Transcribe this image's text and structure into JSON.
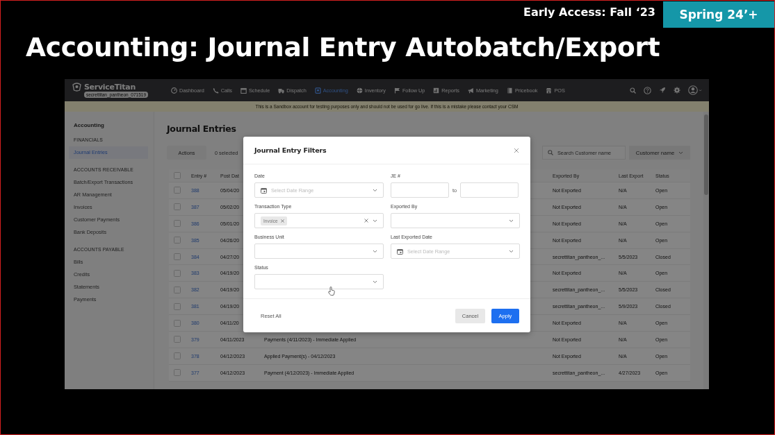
{
  "slide": {
    "early_access": "Early Access: Fall ‘23",
    "release_tag": "Spring 24’+",
    "title": "Accounting: Journal Entry Autobatch/Export"
  },
  "app": {
    "nav": {
      "logo": "ServiceTitan",
      "account": "secrettitan_pantheon_071519",
      "items": [
        {
          "label": "Dashboard",
          "selected": false
        },
        {
          "label": "Calls",
          "selected": false
        },
        {
          "label": "Schedule",
          "selected": false
        },
        {
          "label": "Dispatch",
          "selected": false
        },
        {
          "label": "Accounting",
          "selected": true
        },
        {
          "label": "Inventory",
          "selected": false
        },
        {
          "label": "Follow Up",
          "selected": false
        },
        {
          "label": "Reports",
          "selected": false
        },
        {
          "label": "Marketing",
          "selected": false
        },
        {
          "label": "Pricebook",
          "selected": false
        },
        {
          "label": "POS",
          "selected": false
        }
      ]
    },
    "banner": "This is a Sandbox account for testing purposes only and should not be used for go live. If this is a mistake please contact your CSM",
    "sidebar": {
      "heading": "Accounting",
      "sections": [
        {
          "title": "FINANCIALS",
          "items": [
            {
              "label": "Journal Entries",
              "selected": true
            }
          ]
        },
        {
          "title": "ACCOUNTS RECEIVABLE",
          "items": [
            {
              "label": "Batch/Export Transactions",
              "selected": false
            },
            {
              "label": "AR Management",
              "selected": false
            },
            {
              "label": "Invoices",
              "selected": false
            },
            {
              "label": "Customer Payments",
              "selected": false
            },
            {
              "label": "Bank Deposits",
              "selected": false
            }
          ]
        },
        {
          "title": "ACCOUNTS PAYABLE",
          "items": [
            {
              "label": "Bills",
              "selected": false
            },
            {
              "label": "Credits",
              "selected": false
            },
            {
              "label": "Statements",
              "selected": false
            },
            {
              "label": "Payments",
              "selected": false
            }
          ]
        }
      ]
    },
    "page_title": "Journal Entries",
    "toolbar": {
      "actions": "Actions",
      "selected_count": "0 selected",
      "search_placeholder": "Search Customer name",
      "filter_dropdown": "Customer name"
    },
    "table": {
      "select_all_checked": false,
      "columns": [
        "Entry #",
        "Post Dat",
        "Exported By",
        "Last Export",
        "Status"
      ],
      "rows": [
        {
          "checked": false,
          "entry": "388",
          "post_date": "05/04/20",
          "exported_by": "Not Exported",
          "last_export": "N/A",
          "status": "Open"
        },
        {
          "checked": false,
          "entry": "387",
          "post_date": "05/02/20",
          "exported_by": "Not Exported",
          "last_export": "N/A",
          "status": "Open"
        },
        {
          "checked": false,
          "entry": "386",
          "post_date": "05/01/20",
          "exported_by": "Not Exported",
          "last_export": "N/A",
          "status": "Open"
        },
        {
          "checked": false,
          "entry": "385",
          "post_date": "04/26/20",
          "exported_by": "Not Exported",
          "last_export": "N/A",
          "status": "Open"
        },
        {
          "checked": false,
          "entry": "384",
          "post_date": "04/27/20",
          "exported_by": "secrettitan_pantheon_...",
          "last_export": "5/5/2023",
          "status": "Closed"
        },
        {
          "checked": false,
          "entry": "383",
          "post_date": "04/19/20",
          "exported_by": "Not Exported",
          "last_export": "N/A",
          "status": "Open"
        },
        {
          "checked": false,
          "entry": "382",
          "post_date": "04/19/20",
          "exported_by": "secrettitan_pantheon_...",
          "last_export": "5/5/2023",
          "status": "Closed"
        },
        {
          "checked": false,
          "entry": "381",
          "post_date": "04/19/20",
          "exported_by": "secrettitan_pantheon_...",
          "last_export": "5/9/2023",
          "status": "Closed"
        },
        {
          "checked": false,
          "entry": "380",
          "post_date": "04/11/20",
          "exported_by": "Not Exported",
          "last_export": "N/A",
          "status": "Open"
        },
        {
          "checked": false,
          "entry": "379",
          "post_date": "04/11/2023",
          "description": "Payments (4/11/2023) - Immediate Applied",
          "exported_by": "Not Exported",
          "last_export": "N/A",
          "status": "Open"
        },
        {
          "checked": false,
          "entry": "378",
          "post_date": "04/12/2023",
          "description": "Applied Payment(s) - 04/12/2023",
          "exported_by": "Not Exported",
          "last_export": "N/A",
          "status": "Open"
        },
        {
          "checked": false,
          "entry": "377",
          "post_date": "04/12/2023",
          "description": "Payment (4/12/2023) - Immediate Applied",
          "exported_by": "secrettitan_pantheon_...",
          "last_export": "4/27/2023",
          "status": "Open"
        }
      ]
    },
    "modal": {
      "title": "Journal Entry Filters",
      "fields": [
        {
          "label": "Date",
          "kind": "date-range",
          "placeholder": "Select Date Range"
        },
        {
          "label": "JE #",
          "kind": "number-range",
          "separator": "to"
        },
        {
          "label": "Transaction Type",
          "kind": "multiselect",
          "chips": [
            "Invoice"
          ]
        },
        {
          "label": "Exported By",
          "kind": "select"
        },
        {
          "label": "Business Unit",
          "kind": "select"
        },
        {
          "label": "Last Exported Date",
          "kind": "date-range",
          "placeholder": "Select Date Range"
        },
        {
          "label": "Status",
          "kind": "select"
        }
      ],
      "reset": "Reset All",
      "cancel": "Cancel",
      "apply": "Apply"
    }
  }
}
